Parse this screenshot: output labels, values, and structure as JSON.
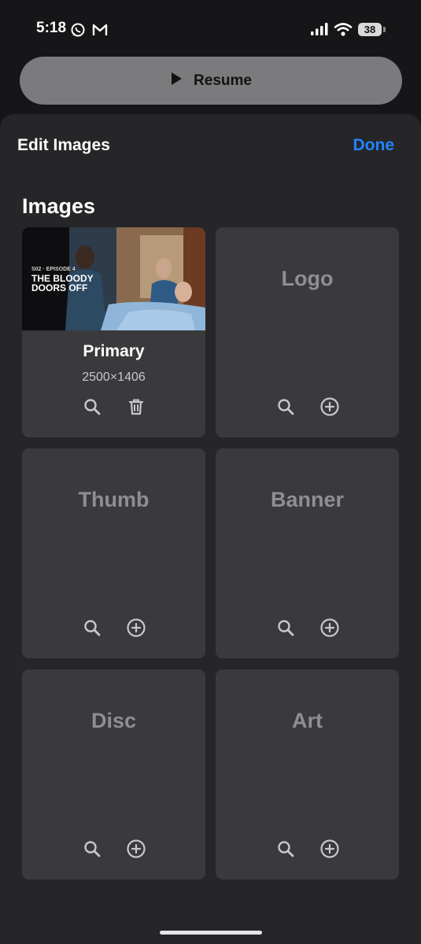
{
  "status_bar": {
    "time": "5:18",
    "battery": "38",
    "icons": [
      "whatsapp-icon",
      "gmail-icon",
      "signal-icon",
      "wifi-icon",
      "battery-icon"
    ]
  },
  "resume": {
    "label": "Resume",
    "icon": "play-icon"
  },
  "sheet": {
    "title": "Edit Images",
    "done_label": "Done",
    "accent_color": "#1f84ff",
    "section_title": "Images",
    "primary": {
      "title": "Primary",
      "dimensions": "2500×1406",
      "poster_lines": [
        "S02 · EPISODE 4",
        "THE BLOODY",
        "DOORS OFF"
      ],
      "actions": [
        "search-icon",
        "trash-icon"
      ]
    },
    "slots": [
      {
        "label": "Logo",
        "actions": [
          "search-icon",
          "add-circle-icon"
        ]
      },
      {
        "label": "Thumb",
        "actions": [
          "search-icon",
          "add-circle-icon"
        ]
      },
      {
        "label": "Banner",
        "actions": [
          "search-icon",
          "add-circle-icon"
        ]
      },
      {
        "label": "Disc",
        "actions": [
          "search-icon",
          "add-circle-icon"
        ]
      },
      {
        "label": "Art",
        "actions": [
          "search-icon",
          "add-circle-icon"
        ]
      }
    ]
  }
}
